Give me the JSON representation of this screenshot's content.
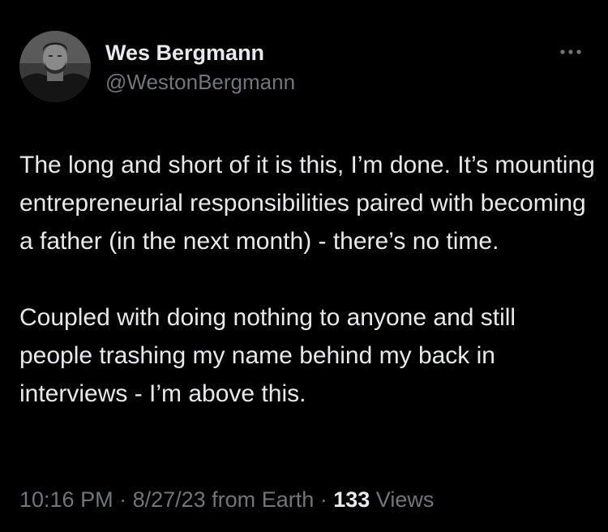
{
  "author": {
    "display_name": "Wes Bergmann",
    "handle": "@WestonBergmann"
  },
  "tweet": {
    "paragraphs": [
      "The long and short of it is this, I’m done. It’s mounting entrepreneurial responsibilities paired with becoming a father (in the next month) - there’s no time.",
      "Coupled with doing nothing to anyone and still people trashing my name behind my back in interviews - I’m above this."
    ]
  },
  "meta": {
    "time": "10:16 PM",
    "separator": " · ",
    "date": "8/27/23",
    "source_prefix": " from ",
    "source": "Earth",
    "views_count": "133",
    "views_label": " Views"
  },
  "icons": {
    "more": "more-horizontal-icon"
  },
  "colors": {
    "background": "#000000",
    "primary_text": "#e7e9ea",
    "secondary_text": "#71767b"
  }
}
